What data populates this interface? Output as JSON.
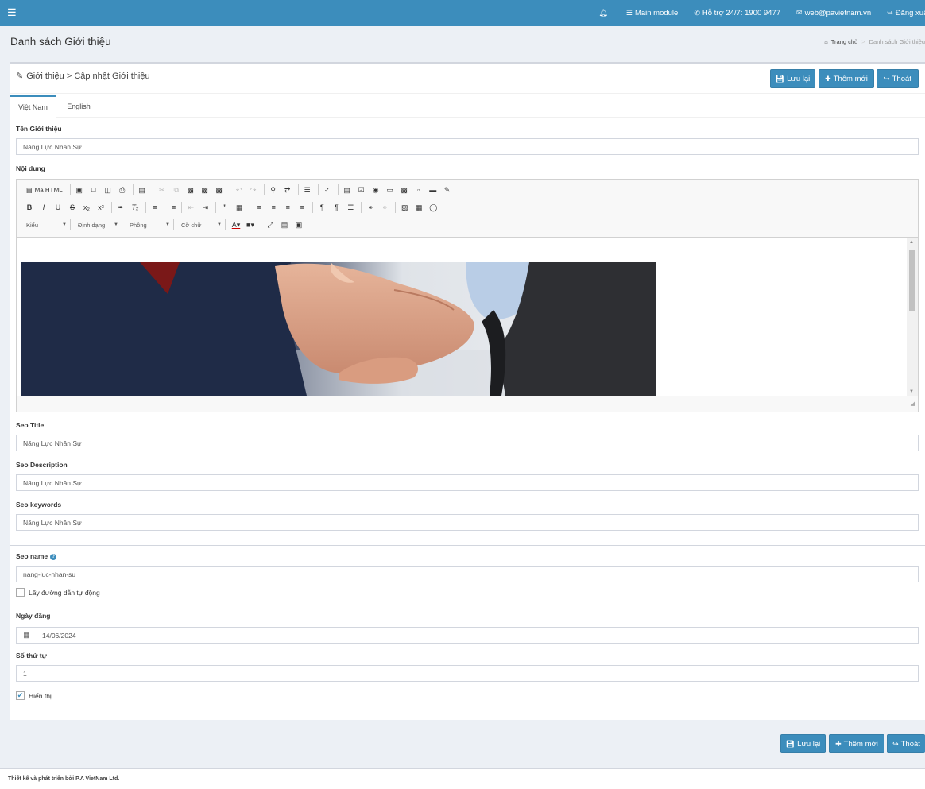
{
  "topbar": {
    "menu_icon": "hamburger-icon",
    "items": [
      {
        "icon": "bell-icon",
        "label": ""
      },
      {
        "icon": "list-icon",
        "label": "Main module"
      },
      {
        "icon": "phone-icon",
        "label": "Hỗ trợ 24/7: 1900 9477"
      },
      {
        "icon": "envelope-icon",
        "label": "web@pavietnam.vn"
      },
      {
        "icon": "sign-out-icon",
        "label": "Đăng xuất"
      }
    ],
    "bg_color": "#3c8dbc"
  },
  "header": {
    "title": "Danh sách Giới thiệu",
    "breadcrumb_home": "Trang chủ",
    "breadcrumb_current": "Danh sách Giới thiệu"
  },
  "form": {
    "title": "Giới thiệu > Cập nhật Giới thiệu",
    "buttons": {
      "save": "Lưu lại",
      "add": "Thêm mới",
      "exit": "Thoát"
    },
    "tabs": [
      {
        "label": "Việt Nam",
        "active": true
      },
      {
        "label": "English",
        "active": false
      }
    ],
    "name_label": "Tên Giới thiệu",
    "name_value": "Năng Lực Nhân Sự",
    "content_label": "Nội dung",
    "editor": {
      "source_label": "Mã HTML",
      "combo_style": "Kiểu",
      "combo_format": "Định dạng",
      "combo_font": "Phông",
      "combo_size": "Cỡ chữ"
    },
    "seo_title_label": "Seo Title",
    "seo_title_value": "Năng Lực Nhân Sự",
    "seo_desc_label": "Seo Description",
    "seo_desc_value": "Năng Lực Nhân Sự",
    "seo_kw_label": "Seo keywords",
    "seo_kw_value": "Năng Lực Nhân Sự",
    "seo_name_label": "Seo name",
    "seo_name_value": "nang-luc-nhan-su",
    "auto_path_label": "Lấy đường dẫn tự động",
    "auto_path_checked": false,
    "date_label": "Ngày đăng",
    "date_value": "14/06/2024",
    "order_label": "Số thứ tự",
    "order_value": "1",
    "visible_label": "Hiển thị",
    "visible_checked": true
  },
  "footer": {
    "text": "Thiết kế và phát triển bởi P.A VietNam Ltd."
  }
}
